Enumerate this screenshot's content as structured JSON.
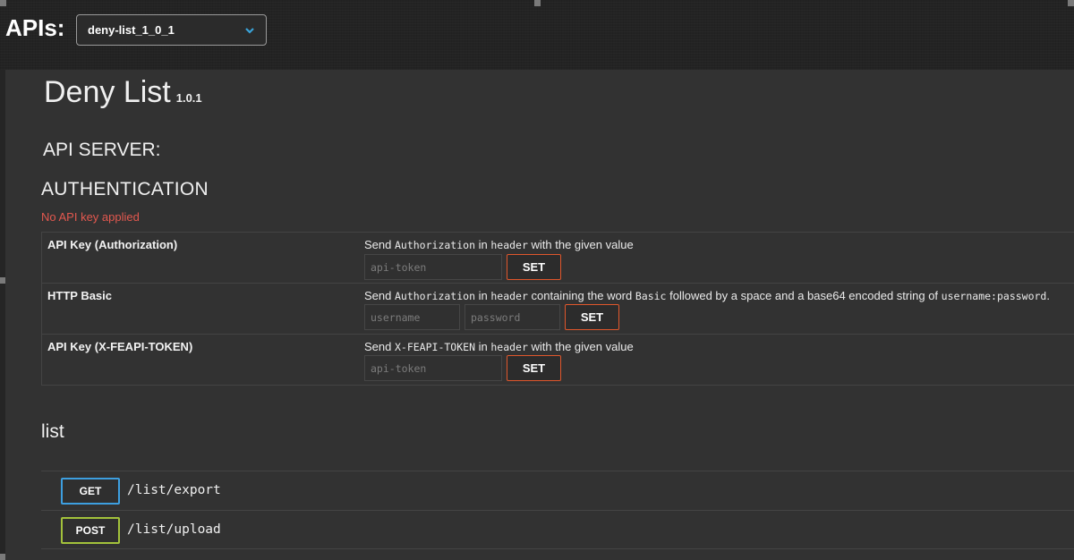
{
  "header": {
    "apis_label": "APIs:",
    "selected_api": "deny-list_1_0_1"
  },
  "info": {
    "title": "Deny List",
    "version": "1.0.1",
    "server_label": "API SERVER:"
  },
  "authentication": {
    "heading": "AUTHENTICATION",
    "status": "No API key applied",
    "schemes": [
      {
        "name": "API Key (Authorization)",
        "desc_prefix": "Send ",
        "desc_code1": "Authorization",
        "desc_mid1": " in ",
        "desc_code2": "header",
        "desc_suffix": " with the given value",
        "placeholder": "api-token",
        "button": "SET"
      },
      {
        "name": "HTTP Basic",
        "desc_prefix": "Send ",
        "desc_code1": "Authorization",
        "desc_mid1": " in ",
        "desc_code2": "header",
        "desc_mid2": " containing the word ",
        "desc_code3": "Basic",
        "desc_mid3": " followed by a space and a base64 encoded string of ",
        "desc_code4": "username:password",
        "desc_suffix": ".",
        "placeholder_user": "username",
        "placeholder_pass": "password",
        "button": "SET"
      },
      {
        "name": "API Key (X-FEAPI-TOKEN)",
        "desc_prefix": "Send ",
        "desc_code1": "X-FEAPI-TOKEN",
        "desc_mid1": " in ",
        "desc_code2": "header",
        "desc_suffix": " with the given value",
        "placeholder": "api-token",
        "button": "SET"
      }
    ]
  },
  "endpoints": {
    "section": "list",
    "items": [
      {
        "method": "GET",
        "path": "/list/export",
        "color": "#3d9fe0"
      },
      {
        "method": "POST",
        "path": "/list/upload",
        "color": "#a3c23b"
      }
    ]
  },
  "colors": {
    "accent_set": "#e0572c",
    "status_error": "#e2584f"
  }
}
